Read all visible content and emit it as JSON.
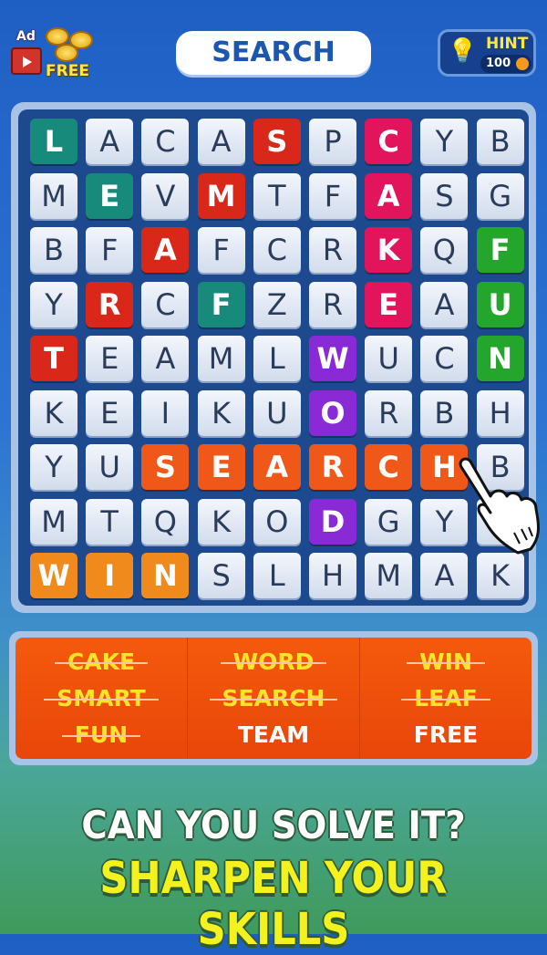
{
  "header": {
    "ad_label": "Ad",
    "free_label": "FREE",
    "title": "SEARCH",
    "hint_label": "HINT",
    "hint_cost": "100"
  },
  "grid": {
    "rows": [
      "LACASPCYB",
      "MEVMTFASG",
      "BFAFCRKQF",
      "YRCFZREAU",
      "TEAMLWUCN",
      "KEIKUORBH",
      "YUSEARCHB",
      "MTQKODGY ",
      "WINSLHMAK"
    ],
    "highlights": [
      "t...r.p..",
      ".t.r..p..",
      "..r...p.g",
      ".r.t..p.g",
      "r....v..g",
      ".....v...",
      "..oooooo.",
      ".....v...",
      "yyy......"
    ],
    "colors": {
      "t": "#178a7c",
      "r": "#d9271a",
      "p": "#e2145c",
      "g": "#24a52c",
      "v": "#8a2ad6",
      "o": "#f0581a",
      "y": "#f08a1c"
    }
  },
  "words": [
    [
      {
        "text": "CAKE",
        "found": true
      },
      {
        "text": "SMART",
        "found": true
      },
      {
        "text": "FUN",
        "found": true
      }
    ],
    [
      {
        "text": "WORD",
        "found": true
      },
      {
        "text": "SEARCH",
        "found": true
      },
      {
        "text": "TEAM",
        "found": false
      }
    ],
    [
      {
        "text": "WIN",
        "found": true
      },
      {
        "text": "LEAF",
        "found": true
      },
      {
        "text": "FREE",
        "found": false
      }
    ]
  ],
  "promo": {
    "line1": "CAN YOU SOLVE IT?",
    "line2": "SHARPEN YOUR SKILLS"
  }
}
